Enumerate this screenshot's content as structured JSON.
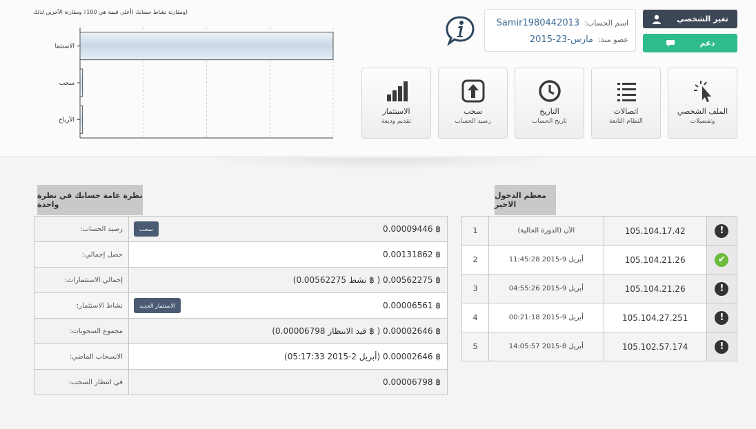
{
  "chart_data": {
    "type": "bar",
    "orientation": "horizontal",
    "title": "(ومقارنة نشاط حسابك (أعلى قيمة هي 100٪ ومقارنة الآخرين لذلك",
    "categories": [
      "الاستثمار",
      "سحب",
      "الأرباح"
    ],
    "values": [
      100,
      1,
      1
    ],
    "xlim": [
      0,
      100
    ],
    "grid": true
  },
  "account": {
    "name_label": "اسم الحساب:",
    "name_value": "Samir1980442013",
    "member_label": "عضو منذ:",
    "member_value": "مارس-23-2015"
  },
  "buttons": {
    "profile": "تغير الشخصي",
    "support": "دعم",
    "withdraw_small": "سحب",
    "new_invest": "الاستثمار الجديد"
  },
  "tiles": [
    {
      "title": "الملف الشخصي",
      "sub": "وتفضيلات",
      "icon": "cursor-click-icon"
    },
    {
      "title": "اتصالات",
      "sub": "النظام التابعة",
      "icon": "list-icon"
    },
    {
      "title": "التاريخ",
      "sub": "تاريخ الحساب",
      "icon": "clock-icon"
    },
    {
      "title": "سحب",
      "sub": "رصيد الحساب",
      "icon": "upload-arrow-icon"
    },
    {
      "title": "الاستثمار",
      "sub": "تقديم وديعة",
      "icon": "bar-chart-icon"
    }
  ],
  "overview": {
    "title": "نظرة عامة حسابك في نظرة واحدة",
    "rows": [
      {
        "label": "رصيد الحساب:",
        "value": "0.00009446 ฿"
      },
      {
        "label": "حصل إجمالي:",
        "value": "0.00131862 ฿"
      },
      {
        "label": "إجمالي الاستثمارات:",
        "value": "(نشط 0.00562275 ฿ ) 0.00562275 ฿"
      },
      {
        "label": "نشاط الاستثمار:",
        "value": "0.00006561 ฿"
      },
      {
        "label": "مجموع السحوبات:",
        "value": "(قيد الانتظار 0.00006798 ฿ ) 0.00002646 ฿"
      },
      {
        "label": "الانسحاب الماضي:",
        "value": "(أبريل 2-2015 05:17:33) 0.00002646 ฿"
      },
      {
        "label": "في انتظار السحب:",
        "value": "0.00006798 ฿"
      }
    ]
  },
  "logins": {
    "title": "معظم الدخول الاخير",
    "rows": [
      {
        "num": "1",
        "date": "(الآن (الدورة الحالية",
        "ip": "105.104.17.42",
        "status": "warning"
      },
      {
        "num": "2",
        "date": "أبريل 9-2015 11:45:28",
        "ip": "105.104.21.26",
        "status": "ok"
      },
      {
        "num": "3",
        "date": "أبريل 9-2015 04:55:26",
        "ip": "105.104.21.26",
        "status": "warning"
      },
      {
        "num": "4",
        "date": "أبريل 9-2015 00:21:18",
        "ip": "105.104.27.251",
        "status": "warning"
      },
      {
        "num": "5",
        "date": "أبريل 8-2015 14:05:57",
        "ip": "105.102.57.174",
        "status": "warning"
      }
    ]
  }
}
